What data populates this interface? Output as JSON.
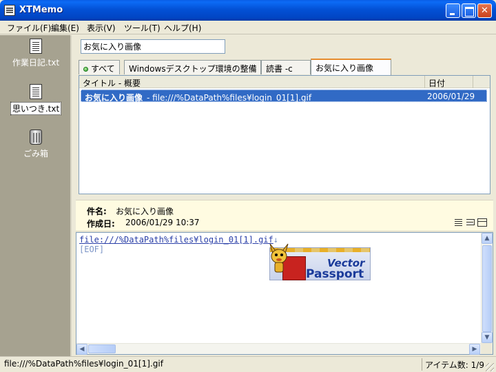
{
  "window": {
    "title": "XTMemo",
    "controls": {
      "minimize": "minimize-icon",
      "maximize": "maximize-icon",
      "close": "close-icon"
    }
  },
  "menu": [
    {
      "label": "ファイル(F)"
    },
    {
      "label": "編集(E)"
    },
    {
      "label": "表示(V)"
    },
    {
      "label": "ツール(T)"
    },
    {
      "label": "ヘルプ(H)"
    }
  ],
  "sidebar": {
    "items": [
      {
        "label": "作業日記.txt",
        "icon": "document-icon",
        "selected": false
      },
      {
        "label": "思いつき.txt",
        "icon": "document-icon",
        "selected": true
      },
      {
        "label": "ごみ箱",
        "icon": "trash-icon",
        "selected": false
      }
    ]
  },
  "title_field": {
    "value": "お気に入り画像"
  },
  "tabs": [
    {
      "label": "すべて",
      "active": false,
      "icon": "green-dot-icon"
    },
    {
      "label": "Windowsデスクトップ環境の整備",
      "active": false
    },
    {
      "label": "読書 -c",
      "active": false
    },
    {
      "label": "お気に入り画像",
      "active": true
    }
  ],
  "list": {
    "columns": [
      {
        "label": "タイトル - 概要"
      },
      {
        "label": "日付"
      }
    ],
    "rows": [
      {
        "title": "お気に入り画像",
        "summary": "- file:///%DataPath%files¥login_01[1].gif",
        "date": "2006/01/29",
        "selected": true
      }
    ]
  },
  "detail": {
    "subject_label": "件名:",
    "subject_value": "お気に入り画像",
    "created_label": "作成日:",
    "created_value": "2006/01/29 10:37",
    "view_icons": [
      "lines-view-icon",
      "wrap-view-icon",
      "frame-view-icon"
    ]
  },
  "editor": {
    "line1": "file:///%DataPath%files¥login_01[1].gif",
    "eol_mark": "↓",
    "line2": "[EOF]",
    "image": {
      "brand": "Vector",
      "product": "Passport",
      "icon": "vector-passport-banner"
    }
  },
  "statusbar": {
    "path": "file:///%DataPath%files¥login_01[1].gif",
    "item_count": "アイテム数: 1/9"
  },
  "colors": {
    "titlebar": "#0351d6",
    "selection": "#316ac5",
    "detail_bg": "#fffbe1",
    "sidebar_bg": "#a6a290",
    "active_tab_accent": "#e68b2c"
  }
}
